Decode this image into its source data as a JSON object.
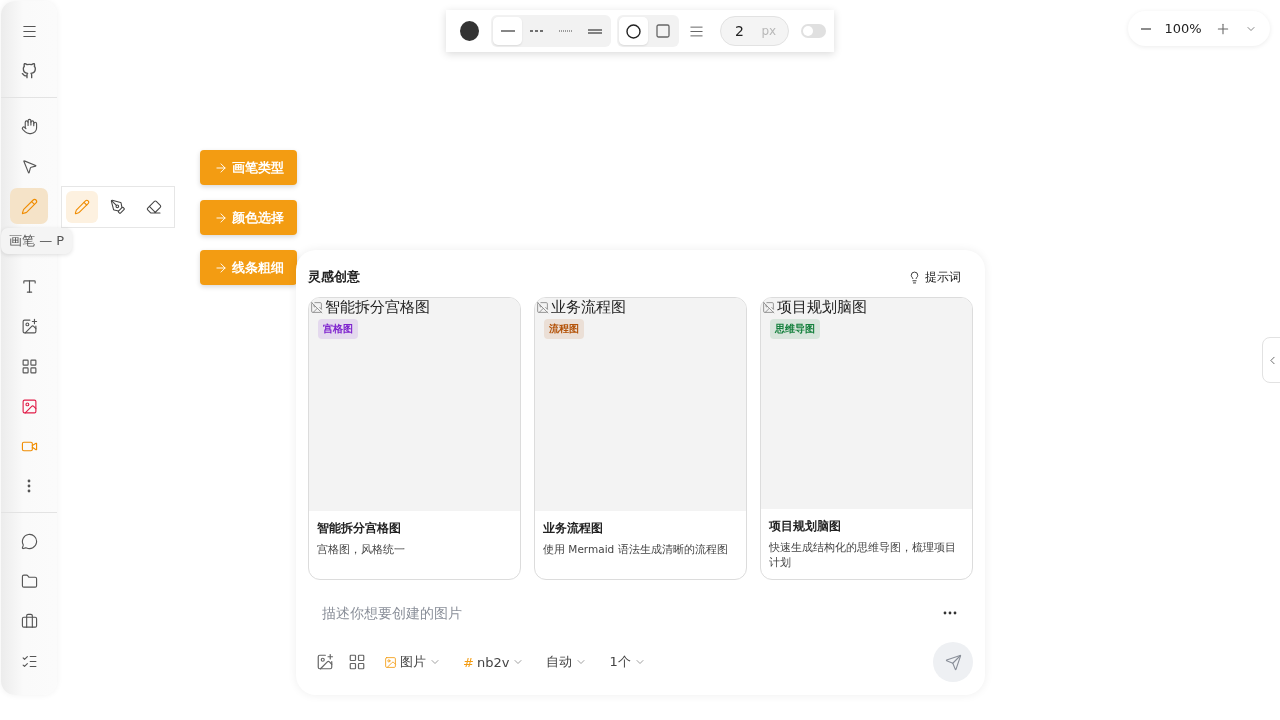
{
  "sidebar": {
    "top": [
      {
        "kind": "menu"
      },
      {
        "kind": "github"
      }
    ],
    "tools": [
      {
        "kind": "hand",
        "selected": false
      },
      {
        "kind": "pointer",
        "selected": false
      },
      {
        "kind": "pencil",
        "selected": true,
        "tooltip": "画笔 — P"
      },
      {
        "kind": "text",
        "selected": false
      },
      {
        "kind": "image-add",
        "selected": false
      },
      {
        "kind": "grid",
        "selected": false
      },
      {
        "kind": "image",
        "selected": false
      },
      {
        "kind": "video",
        "selected": false
      },
      {
        "kind": "more",
        "selected": false
      }
    ],
    "bottom": [
      {
        "kind": "chat"
      },
      {
        "kind": "folder"
      },
      {
        "kind": "briefcase"
      },
      {
        "kind": "checklist"
      }
    ]
  },
  "pen_options": [
    {
      "kind": "pencil",
      "selected": true
    },
    {
      "kind": "pen",
      "selected": false
    },
    {
      "kind": "eraser",
      "selected": false
    }
  ],
  "guide_buttons": [
    {
      "label": "画笔类型"
    },
    {
      "label": "颜色选择"
    },
    {
      "label": "线条粗细"
    }
  ],
  "style_toolbar": {
    "line_styles": [
      {
        "kind": "solid",
        "selected": true
      },
      {
        "kind": "dashed",
        "selected": false
      },
      {
        "kind": "dotted",
        "selected": false
      },
      {
        "kind": "double",
        "selected": false
      }
    ],
    "shapes": [
      {
        "kind": "circle",
        "selected": true
      },
      {
        "kind": "square",
        "selected": false
      }
    ],
    "width": {
      "value": "2",
      "unit": "px"
    },
    "toggle": {
      "on": false
    }
  },
  "zoom": {
    "value": "100%"
  },
  "panel": {
    "title": "灵感创意",
    "prompt_button": "提示词",
    "cards": [
      {
        "alt": "智能拆分宫格图",
        "badge": "宫格图",
        "color": "#7e22ce",
        "title": "智能拆分宫格图",
        "description": "宫格图，风格统一"
      },
      {
        "alt": "业务流程图",
        "badge": "流程图",
        "color": "#b45309",
        "title": "业务流程图",
        "description": "使用 Mermaid 语法生成清晰的流程图"
      },
      {
        "alt": "项目规划脑图",
        "badge": "思维导图",
        "color": "#15803d",
        "title": "项目规划脑图",
        "description": "快速生成结构化的思维导图，梳理项目计划"
      }
    ],
    "input": {
      "placeholder": "描述你想要创建的图片"
    },
    "options": [
      {
        "kind": "type",
        "label": "图片"
      },
      {
        "kind": "model",
        "prefix": "#",
        "label": "nb2v"
      },
      {
        "kind": "plain",
        "label": "自动"
      },
      {
        "kind": "plain",
        "label": "1个"
      }
    ]
  }
}
